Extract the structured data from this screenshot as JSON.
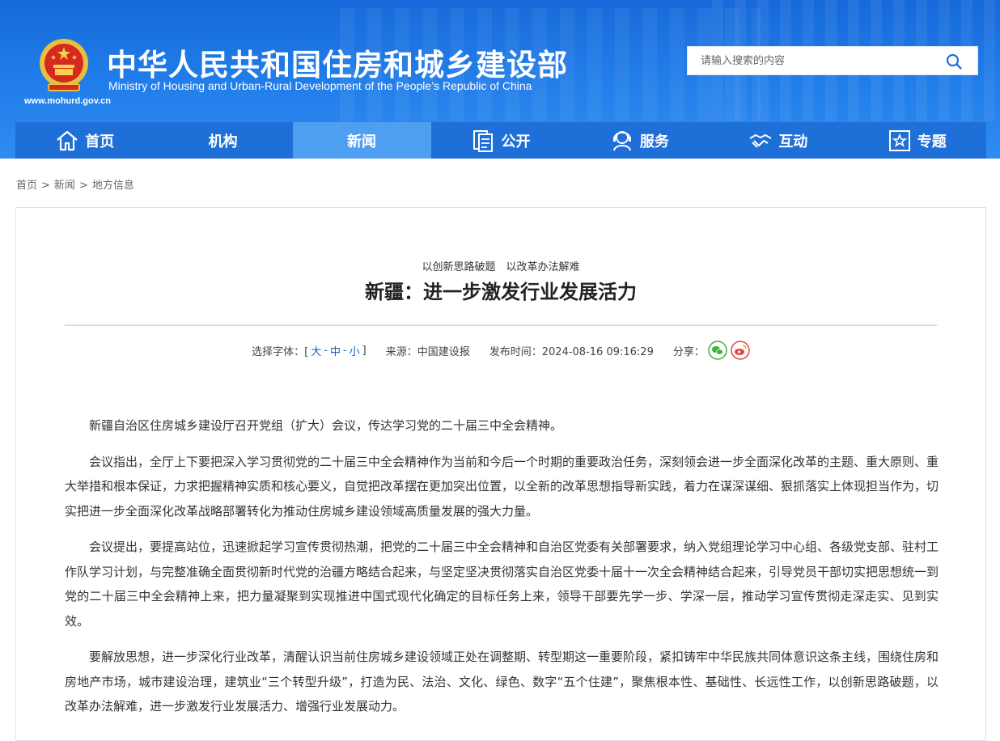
{
  "header": {
    "title": "中华人民共和国住房和城乡建设部",
    "subtitle": "Ministry of Housing and Urban-Rural Development of the People’s Republic of China",
    "url": "www.mohurd.gov.cn",
    "search_placeholder": "请输入搜索的内容"
  },
  "nav": {
    "items": [
      {
        "label": "首页",
        "icon": "home-icon"
      },
      {
        "label": "机构",
        "icon": ""
      },
      {
        "label": "新闻",
        "icon": "",
        "active": true
      },
      {
        "label": "公开",
        "icon": "document-icon"
      },
      {
        "label": "服务",
        "icon": "service-person-icon"
      },
      {
        "label": "互动",
        "icon": "handshake-icon"
      },
      {
        "label": "专题",
        "icon": "star-frame-icon"
      }
    ]
  },
  "breadcrumb": [
    "首页",
    "新闻",
    "地方信息"
  ],
  "article": {
    "kicker": "以创新思路破题　以改革办法解难",
    "title": "新疆：进一步激发行业发展活力",
    "font_label": "选择字体：[",
    "font_large": "大",
    "font_medium": "中",
    "font_small": "小",
    "font_close": "]",
    "source": "来源：中国建设报",
    "publish_time": "发布时间：2024-08-16 09:16:29",
    "share_label": "分享：",
    "paragraphs": [
      "新疆自治区住房城乡建设厅召开党组（扩大）会议，传达学习党的二十届三中全会精神。",
      "会议指出，全厅上下要把深入学习贯彻党的二十届三中全会精神作为当前和今后一个时期的重要政治任务，深刻领会进一步全面深化改革的主题、重大原则、重大举措和根本保证，力求把握精神实质和核心要义，自觉把改革摆在更加突出位置，以全新的改革思想指导新实践，着力在谋深谋细、狠抓落实上体现担当作为，切实把进一步全面深化改革战略部署转化为推动住房城乡建设领域高质量发展的强大力量。",
      "会议提出，要提高站位，迅速掀起学习宣传贯彻热潮，把党的二十届三中全会精神和自治区党委有关部署要求，纳入党组理论学习中心组、各级党支部、驻村工作队学习计划，与完整准确全面贯彻新时代党的治疆方略结合起来，与坚定坚决贯彻落实自治区党委十届十一次全会精神结合起来，引导党员干部切实把思想统一到党的二十届三中全会精神上来，把力量凝聚到实现推进中国式现代化确定的目标任务上来，领导干部要先学一步、学深一层，推动学习宣传贯彻走深走实、见到实效。",
      "要解放思想，进一步深化行业改革，清醒认识当前住房城乡建设领域正处在调整期、转型期这一重要阶段，紧扣铸牢中华民族共同体意识这条主线，围绕住房和房地产市场，城市建设治理，建筑业“三个转型升级”，打造为民、法治、文化、绿色、数字“五个住建”，聚焦根本性、基础性、长远性工作，以创新思路破题，以改革办法解难，进一步激发行业发展活力、增强行业发展动力。"
    ]
  },
  "colors": {
    "header_blue": "#1f7be8",
    "nav_blue": "#1f6fd8",
    "nav_active": "#4e9ef2",
    "link_blue": "#1a5fb4",
    "wechat_green": "#3cb034",
    "weibo_red": "#e2463c"
  }
}
